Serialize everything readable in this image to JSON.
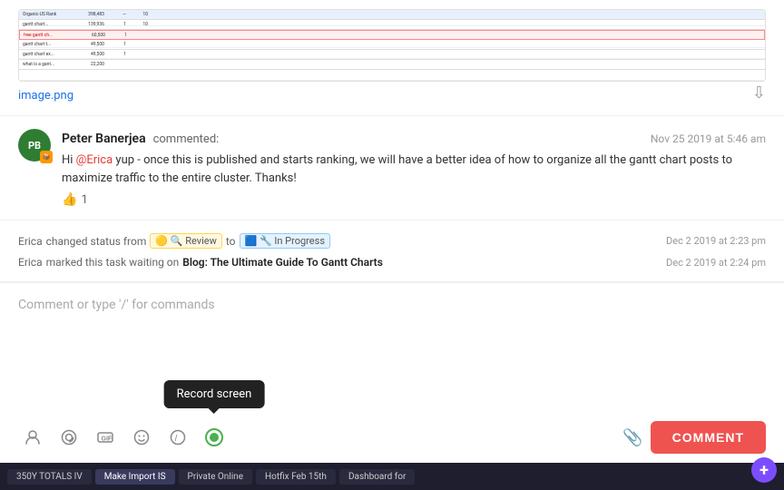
{
  "image": {
    "filename": "image.png",
    "download_tooltip": "Download"
  },
  "comment": {
    "author": "Peter Banerjea",
    "author_initials": "PB",
    "action": "commented:",
    "timestamp": "Nov 25 2019 at 5:46 am",
    "text_before_mention": "Hi ",
    "mention": "@Erica",
    "text_after_mention": " yup - once this is published and starts ranking, we will have a better idea of how to organize all the gantt chart posts to maximize traffic to the entire cluster. Thanks!",
    "likes": "1"
  },
  "activities": [
    {
      "actor": "Erica",
      "action": "changed status from",
      "from_status": "Review",
      "arrow": "to",
      "to_status": "In Progress",
      "timestamp": "Dec 2 2019 at 2:23 pm"
    },
    {
      "actor": "Erica",
      "action": "marked this task waiting on",
      "link": "Blog: The Ultimate Guide To Gantt Charts",
      "timestamp": "Dec 2 2019 at 2:24 pm"
    }
  ],
  "input": {
    "placeholder": "Comment or type '/' for commands"
  },
  "toolbar": {
    "record_screen_tooltip": "Record screen",
    "comment_button": "COMMENT"
  },
  "taskbar": {
    "items": [
      "350Y TOTALS IV",
      "Make Import IS",
      "Private Online",
      "Hotfix Feb 15th",
      "Dashboard for"
    ]
  }
}
